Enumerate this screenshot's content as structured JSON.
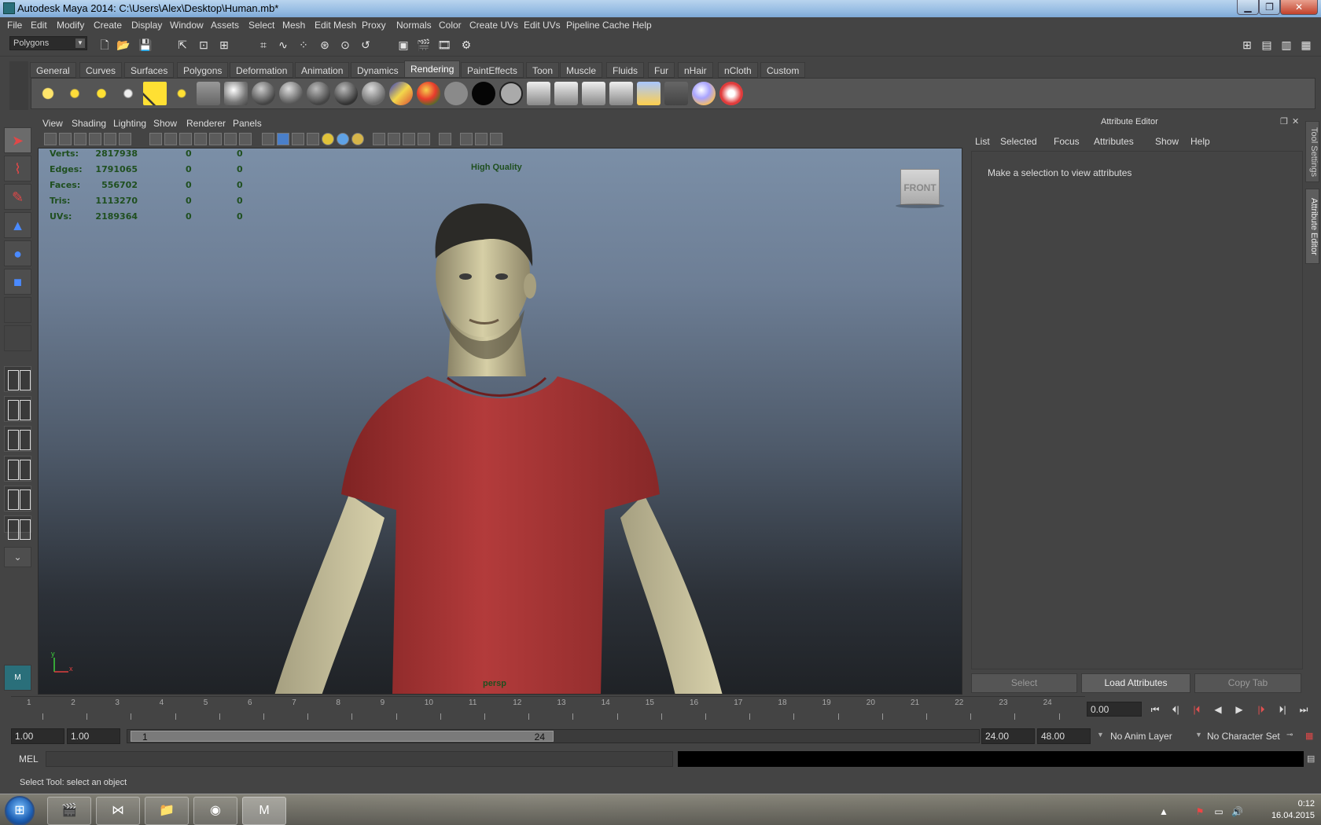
{
  "window": {
    "title": "Autodesk Maya 2014: C:\\Users\\Alex\\Desktop\\Human.mb*",
    "min_glyph": "▁",
    "max_glyph": "❐",
    "close_glyph": "✕"
  },
  "menubar": [
    "File",
    "Edit",
    "Modify",
    "Create",
    "Display",
    "Window",
    "Assets",
    "Select",
    "Mesh",
    "Edit Mesh",
    "Proxy",
    "Normals",
    "Color",
    "Create UVs",
    "Edit UVs",
    "Pipeline Cache",
    "Help"
  ],
  "toolbar": {
    "mode": "Polygons"
  },
  "shelf": {
    "tabs": [
      "General",
      "Curves",
      "Surfaces",
      "Polygons",
      "Deformation",
      "Animation",
      "Dynamics",
      "Rendering",
      "PaintEffects",
      "Toon",
      "Muscle",
      "Fluids",
      "Fur",
      "nHair",
      "nCloth",
      "Custom"
    ],
    "active_tab": "Rendering"
  },
  "viewport": {
    "menu": [
      "View",
      "Shading",
      "Lighting",
      "Show",
      "Renderer",
      "Panels"
    ],
    "hud": [
      {
        "label": "Verts:",
        "v1": "2817938",
        "v2": "0",
        "v3": "0"
      },
      {
        "label": "Edges:",
        "v1": "1791065",
        "v2": "0",
        "v3": "0"
      },
      {
        "label": "Faces:",
        "v1": "556702",
        "v2": "0",
        "v3": "0"
      },
      {
        "label": "Tris:",
        "v1": "1113270",
        "v2": "0",
        "v3": "0"
      },
      {
        "label": "UVs:",
        "v1": "2189364",
        "v2": "0",
        "v3": "0"
      }
    ],
    "quality": "High Quality",
    "viewcube": "FRONT",
    "camera": "persp",
    "axis_y": "y",
    "axis_x": "x"
  },
  "attribute_editor": {
    "title": "Attribute Editor",
    "menu": [
      "List",
      "Selected",
      "Focus",
      "Attributes",
      "Show",
      "Help"
    ],
    "message": "Make a selection to view attributes",
    "buttons": {
      "select": "Select",
      "load": "Load Attributes",
      "copy": "Copy Tab"
    },
    "side_tabs": [
      "Tool Settings",
      "Attribute Editor"
    ]
  },
  "timeline": {
    "frames": [
      "1",
      "2",
      "3",
      "4",
      "5",
      "6",
      "7",
      "8",
      "9",
      "10",
      "11",
      "12",
      "13",
      "14",
      "15",
      "16",
      "17",
      "18",
      "19",
      "20",
      "21",
      "22",
      "23",
      "24"
    ],
    "current_time": "0.00",
    "playback": [
      "⏮",
      "⏴|",
      "|⏴",
      "◀",
      "▶",
      "|⏵",
      "⏵|",
      "⏭"
    ]
  },
  "range": {
    "start_time": "1.00",
    "playback_start": "1.00",
    "range_start": "1",
    "range_end": "24",
    "playback_end": "24.00",
    "end_time": "48.00",
    "anim_layer": "No Anim Layer",
    "character_set": "No Character Set"
  },
  "command_line": {
    "label": "MEL"
  },
  "help_line": {
    "text": "Select Tool: select an object"
  },
  "taskbar": {
    "clock_time": "0:12",
    "clock_date": "16.04.2015"
  }
}
